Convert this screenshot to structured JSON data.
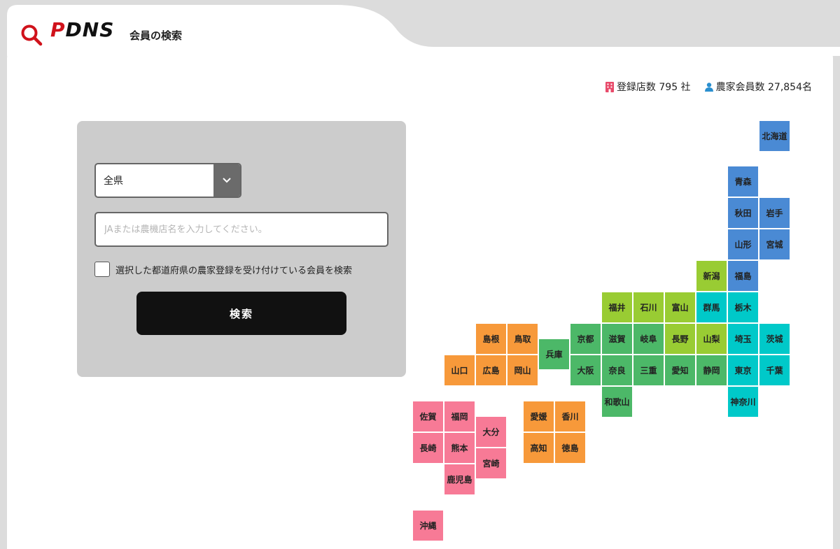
{
  "header": {
    "logo_p": "P",
    "logo_rest": "DNS",
    "title": "会員の検索"
  },
  "stats": {
    "stores": "登録店数 795 社",
    "members": "農家会員数 27,854名"
  },
  "search": {
    "prefecture_selected": "全県",
    "name_placeholder": "JAまたは農機店名を入力してください。",
    "checkbox_label": "選択した都道府県の農家登録を受け付けている会員を検索",
    "button_label": "検索"
  },
  "colors": {
    "hokkaido_tohoku": "#4a8ad4",
    "kanto": "#00c9c9",
    "chubu": "#99cc33",
    "kinki": "#4cb868",
    "chugoku_shikoku": "#f7993a",
    "kyushu_okinawa": "#f77a96"
  },
  "prefectures": [
    {
      "name": "北海道",
      "region": "hokkaido_tohoku"
    },
    {
      "name": "青森",
      "region": "hokkaido_tohoku"
    },
    {
      "name": "秋田",
      "region": "hokkaido_tohoku"
    },
    {
      "name": "岩手",
      "region": "hokkaido_tohoku"
    },
    {
      "name": "山形",
      "region": "hokkaido_tohoku"
    },
    {
      "name": "宮城",
      "region": "hokkaido_tohoku"
    },
    {
      "name": "新潟",
      "region": "chubu"
    },
    {
      "name": "福島",
      "region": "hokkaido_tohoku"
    },
    {
      "name": "福井",
      "region": "chubu"
    },
    {
      "name": "石川",
      "region": "chubu"
    },
    {
      "name": "富山",
      "region": "chubu"
    },
    {
      "name": "群馬",
      "region": "kanto"
    },
    {
      "name": "栃木",
      "region": "kanto"
    },
    {
      "name": "島根",
      "region": "chugoku_shikoku"
    },
    {
      "name": "鳥取",
      "region": "chugoku_shikoku"
    },
    {
      "name": "兵庫",
      "region": "kinki"
    },
    {
      "name": "京都",
      "region": "kinki"
    },
    {
      "name": "滋賀",
      "region": "kinki"
    },
    {
      "name": "岐阜",
      "region": "kinki"
    },
    {
      "name": "長野",
      "region": "chubu"
    },
    {
      "name": "山梨",
      "region": "chubu"
    },
    {
      "name": "埼玉",
      "region": "kanto"
    },
    {
      "name": "茨城",
      "region": "kanto"
    },
    {
      "name": "山口",
      "region": "chugoku_shikoku"
    },
    {
      "name": "広島",
      "region": "chugoku_shikoku"
    },
    {
      "name": "岡山",
      "region": "chugoku_shikoku"
    },
    {
      "name": "大阪",
      "region": "kinki"
    },
    {
      "name": "奈良",
      "region": "kinki"
    },
    {
      "name": "三重",
      "region": "kinki"
    },
    {
      "name": "愛知",
      "region": "kinki"
    },
    {
      "name": "静岡",
      "region": "kinki"
    },
    {
      "name": "東京",
      "region": "kanto"
    },
    {
      "name": "千葉",
      "region": "kanto"
    },
    {
      "name": "和歌山",
      "region": "kinki"
    },
    {
      "name": "神奈川",
      "region": "kanto"
    },
    {
      "name": "佐賀",
      "region": "kyushu_okinawa"
    },
    {
      "name": "福岡",
      "region": "kyushu_okinawa"
    },
    {
      "name": "大分",
      "region": "kyushu_okinawa"
    },
    {
      "name": "愛媛",
      "region": "chugoku_shikoku"
    },
    {
      "name": "香川",
      "region": "chugoku_shikoku"
    },
    {
      "name": "長崎",
      "region": "kyushu_okinawa"
    },
    {
      "name": "熊本",
      "region": "kyushu_okinawa"
    },
    {
      "name": "宮崎",
      "region": "kyushu_okinawa"
    },
    {
      "name": "高知",
      "region": "chugoku_shikoku"
    },
    {
      "name": "徳島",
      "region": "chugoku_shikoku"
    },
    {
      "name": "鹿児島",
      "region": "kyushu_okinawa"
    },
    {
      "name": "沖縄",
      "region": "kyushu_okinawa"
    }
  ]
}
